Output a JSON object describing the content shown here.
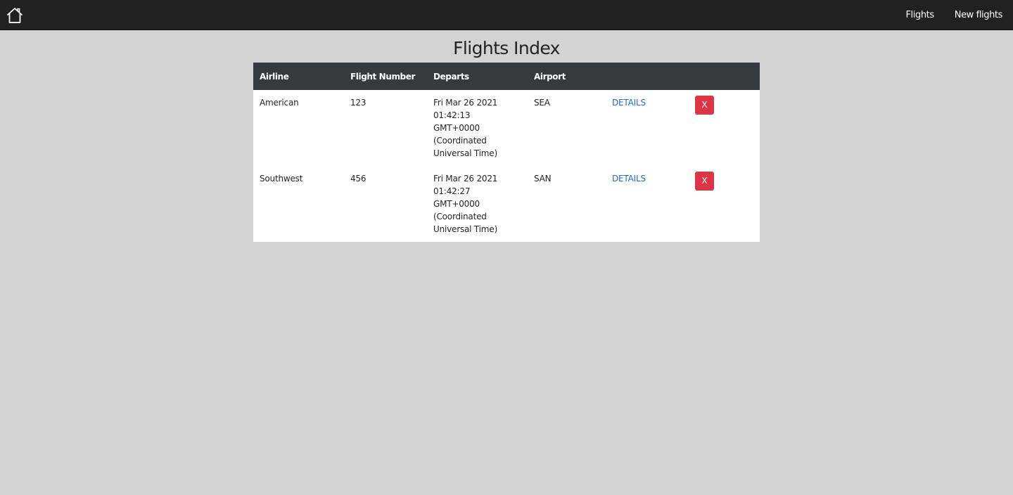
{
  "nav": {
    "home_icon": "home-icon",
    "links": [
      {
        "label": "Flights"
      },
      {
        "label": "New flights"
      }
    ]
  },
  "page": {
    "title": "Flights Index"
  },
  "table": {
    "headers": [
      "Airline",
      "Flight Number",
      "Departs",
      "Airport",
      "",
      ""
    ],
    "rows": [
      {
        "airline": "American",
        "flight_number": "123",
        "departs": "Fri Mar 26 2021 01:42:13 GMT+0000 (Coordinated Universal Time)",
        "airport": "SEA",
        "details_label": "DETAILS",
        "delete_label": "X"
      },
      {
        "airline": "Southwest",
        "flight_number": "456",
        "departs": "Fri Mar 26 2021 01:42:27 GMT+0000 (Coordinated Universal Time)",
        "airport": "SAN",
        "details_label": "DETAILS",
        "delete_label": "X"
      }
    ]
  },
  "colors": {
    "navbar": "#212121",
    "background": "#d3d3d3",
    "table_header": "#343a40",
    "link": "#1e6cc8",
    "delete": "#dc3545"
  }
}
